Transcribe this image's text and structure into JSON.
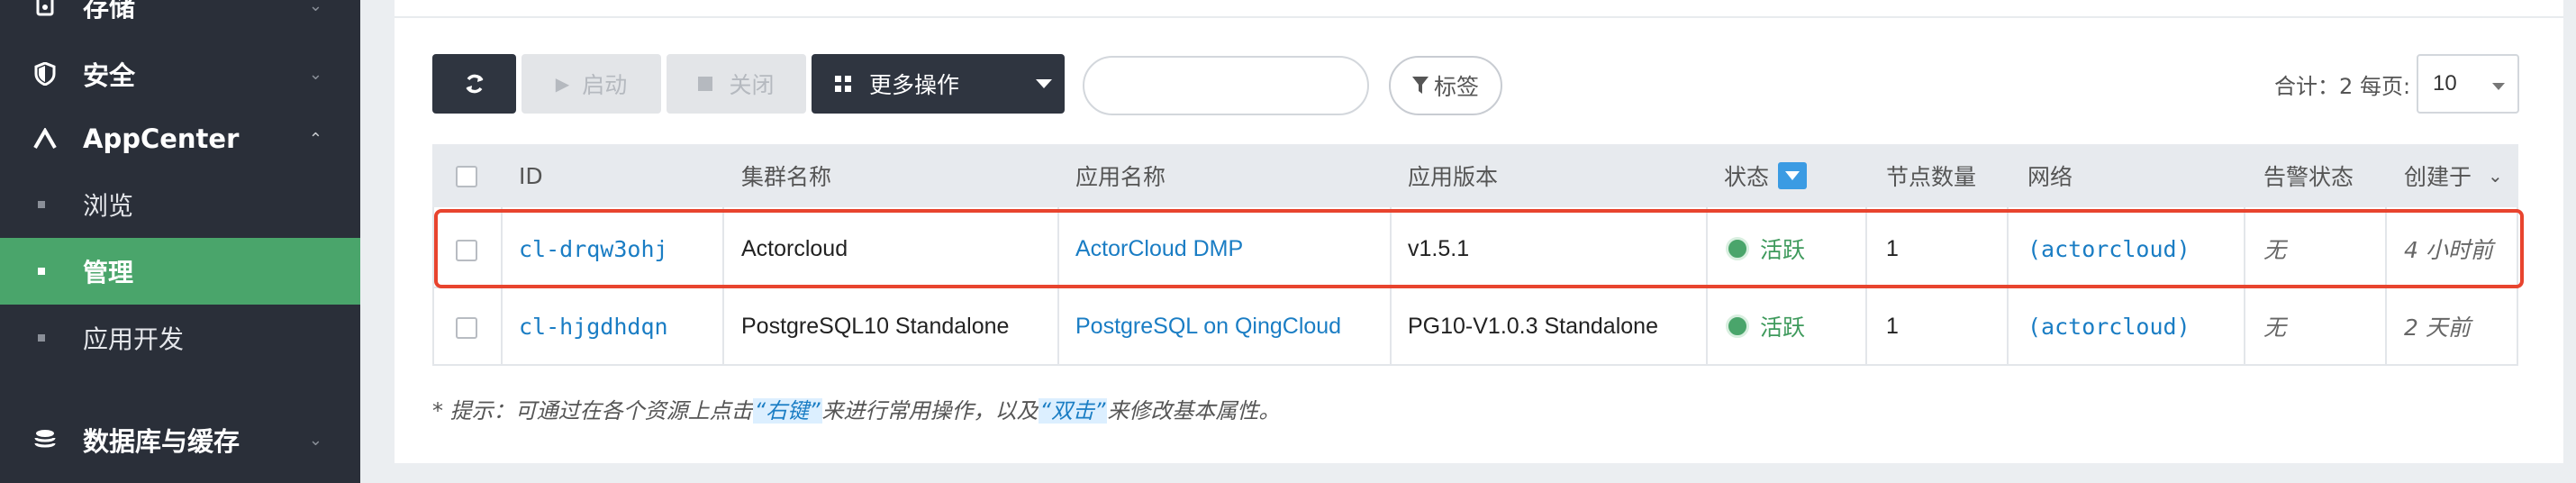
{
  "sidebar": {
    "items": [
      {
        "label": "存储",
        "icon": "storage-icon"
      },
      {
        "label": "安全",
        "icon": "shield-icon"
      },
      {
        "label": "AppCenter",
        "icon": "appcenter-icon"
      },
      {
        "label": "数据库与缓存",
        "icon": "database-icon"
      }
    ],
    "subitems": [
      {
        "label": "浏览"
      },
      {
        "label": "管理"
      },
      {
        "label": "应用开发"
      }
    ]
  },
  "toolbar": {
    "start_label": "启动",
    "close_label": "关闭",
    "more_label": "更多操作",
    "search_placeholder": "",
    "tag_label": "标签",
    "total_label": "合计：2",
    "per_page_label": "每页:",
    "per_page_value": "10"
  },
  "table": {
    "headers": {
      "id": "ID",
      "cluster_name": "集群名称",
      "app_name": "应用名称",
      "app_version": "应用版本",
      "status": "状态",
      "node_count": "节点数量",
      "network": "网络",
      "alarm": "告警状态",
      "created": "创建于"
    },
    "rows": [
      {
        "id": "cl-drqw3ohj",
        "cluster_name": "Actorcloud",
        "app_name": "ActorCloud DMP",
        "app_version": "v1.5.1",
        "status": "活跃",
        "node_count": "1",
        "network": "(actorcloud)",
        "alarm": "无",
        "created": "4 小时前"
      },
      {
        "id": "cl-hjgdhdqn",
        "cluster_name": "PostgreSQL10 Standalone",
        "app_name": "PostgreSQL on QingCloud",
        "app_version": "PG10-V1.0.3 Standalone",
        "status": "活跃",
        "node_count": "1",
        "network": "(actorcloud)",
        "alarm": "无",
        "created": "2 天前"
      }
    ]
  },
  "hint": {
    "prefix": "* 提示：可通过在各个资源上点击",
    "kw1": "“右键”",
    "mid": "来进行常用操作，以及",
    "kw2": "“双击”",
    "suffix": "来修改基本属性。"
  },
  "colors": {
    "sidebar_bg": "#2a2f39",
    "active_bg": "#4aa56b",
    "link": "#1a7dc4",
    "status_green": "#4aa56b",
    "highlight_red": "#e8442e"
  }
}
